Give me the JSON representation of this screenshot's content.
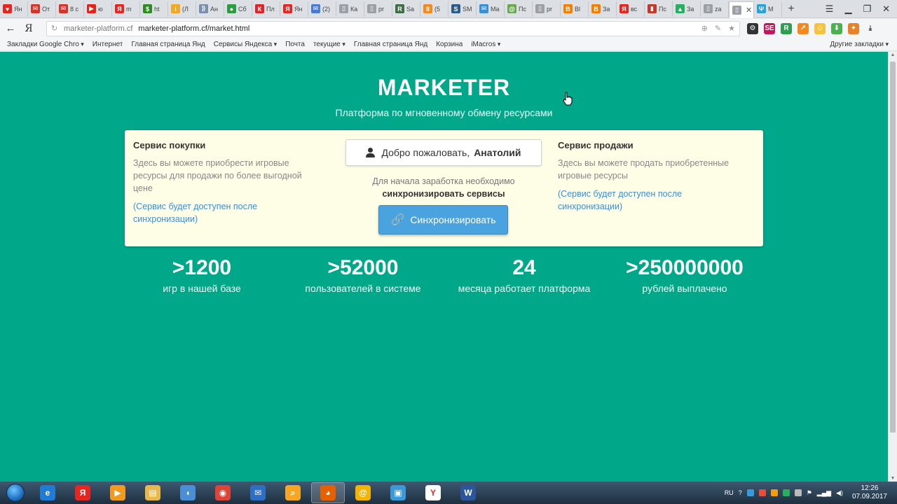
{
  "browser": {
    "tabs": [
      {
        "label": "Ян",
        "fav_color": "#e52620",
        "fav_glyph": "♥"
      },
      {
        "label": "От",
        "fav_color": "#d0362b",
        "fav_glyph": "✉"
      },
      {
        "label": "8 с",
        "fav_color": "#d0362b",
        "fav_glyph": "✉"
      },
      {
        "label": "ю",
        "fav_color": "#e62117",
        "fav_glyph": "▶"
      },
      {
        "label": "m",
        "fav_color": "#e52620",
        "fav_glyph": "Я"
      },
      {
        "label": "ht",
        "fav_color": "#2e8b22",
        "fav_glyph": "$"
      },
      {
        "label": "(Л",
        "fav_color": "#f5a623",
        "fav_glyph": "i"
      },
      {
        "label": "Ан",
        "fav_color": "#7a8fb0",
        "fav_glyph": "⟫"
      },
      {
        "label": "Сб",
        "fav_color": "#2b9c3f",
        "fav_glyph": "●"
      },
      {
        "label": "Пл",
        "fav_color": "#d9262c",
        "fav_glyph": "К"
      },
      {
        "label": "Ян",
        "fav_color": "#e52620",
        "fav_glyph": "Я"
      },
      {
        "label": "(2)",
        "fav_color": "#4a7bd0",
        "fav_glyph": "✉"
      },
      {
        "label": "Ка",
        "fav_color": "#9aa0a6",
        "fav_glyph": "▯"
      },
      {
        "label": "pr",
        "fav_color": "#9aa0a6",
        "fav_glyph": "▯"
      },
      {
        "label": "Sa",
        "fav_color": "#3c6e47",
        "fav_glyph": "R"
      },
      {
        "label": "(5",
        "fav_color": "#f28a1f",
        "fav_glyph": "8"
      },
      {
        "label": "SM",
        "fav_color": "#2a5c8a",
        "fav_glyph": "S"
      },
      {
        "label": "Ma",
        "fav_color": "#3b8fd6",
        "fav_glyph": "✉"
      },
      {
        "label": "Пс",
        "fav_color": "#6aa84f",
        "fav_glyph": "@"
      },
      {
        "label": "pr",
        "fav_color": "#9aa0a6",
        "fav_glyph": "▯"
      },
      {
        "label": "Bl",
        "fav_color": "#f57d00",
        "fav_glyph": "B"
      },
      {
        "label": "За",
        "fav_color": "#f57d00",
        "fav_glyph": "B"
      },
      {
        "label": "вс",
        "fav_color": "#e52620",
        "fav_glyph": "Я"
      },
      {
        "label": "Пс",
        "fav_color": "#c0392b",
        "fav_glyph": "▮"
      },
      {
        "label": "За",
        "fav_color": "#27ae60",
        "fav_glyph": "▲"
      },
      {
        "label": "za",
        "fav_color": "#9aa0a6",
        "fav_glyph": "▯"
      },
      {
        "label": "",
        "fav_color": "#9aa0a6",
        "fav_glyph": "▯",
        "active": true
      },
      {
        "label": "M",
        "fav_color": "#2aa1d8",
        "fav_glyph": "Ψ"
      }
    ],
    "new_tab": "+",
    "address": {
      "host": "marketer-platform.cf",
      "path": "marketer-platform.cf/market.html"
    },
    "bookmarks": [
      {
        "label": "Закладки Google Chro",
        "dropdown": true
      },
      {
        "label": "Интернет",
        "dropdown": false
      },
      {
        "label": "Главная страница Янд",
        "dropdown": false
      },
      {
        "label": "Сервисы Яндекса",
        "dropdown": true
      },
      {
        "label": "Почта",
        "dropdown": false
      },
      {
        "label": "текущие",
        "dropdown": true
      },
      {
        "label": "Главная страница Янд",
        "dropdown": false
      },
      {
        "label": "Корзина",
        "dropdown": false
      },
      {
        "label": "iMacros",
        "dropdown": true
      }
    ],
    "other_bookmarks": "Другие закладки"
  },
  "page": {
    "title": "MARKETER",
    "subtitle": "Платформа по мгновенному обмену ресурсами",
    "buy": {
      "title": "Сервис покупки",
      "text": "Здесь вы можете приобрести игровые ресурсы для продажи по более выгодной цене",
      "note": "(Сервис будет доступен после синхронизации)"
    },
    "welcome": {
      "greeting": "Добро пожаловать,",
      "name": "Анатолий"
    },
    "sync": {
      "note_line1": "Для начала заработка необходимо",
      "note_line2": "синхронизировать сервисы",
      "button": "Синхронизировать"
    },
    "sell": {
      "title": "Сервис продажи",
      "text": "Здесь вы можете продать приобретенные игровые ресурсы",
      "note": "(Сервис будет доступен после синхронизации)"
    },
    "stats": [
      {
        "value": ">1200",
        "label": "игр в нашей базе"
      },
      {
        "value": ">52000",
        "label": "пользователей в системе"
      },
      {
        "value": "24",
        "label": "месяца работает платформа"
      },
      {
        "value": ">250000000",
        "label": "рублей выплачено"
      }
    ]
  },
  "taskbar": {
    "apps": [
      {
        "name": "ie",
        "color": "#1f7bd3",
        "glyph": "e"
      },
      {
        "name": "yandex",
        "color": "#e52620",
        "glyph": "Я"
      },
      {
        "name": "media",
        "color": "#f29a1f",
        "glyph": "▶"
      },
      {
        "name": "explorer",
        "color": "#e8b84a",
        "glyph": "▤"
      },
      {
        "name": "audio",
        "color": "#4a8fd6",
        "glyph": "◖"
      },
      {
        "name": "chrome",
        "color": "#db4437",
        "glyph": "◉"
      },
      {
        "name": "thunderbird",
        "color": "#2d6fc4",
        "glyph": "✉"
      },
      {
        "name": "search",
        "color": "#f6a623",
        "glyph": "⌕"
      },
      {
        "name": "firefox",
        "color": "#e66000",
        "glyph": "◕",
        "active": true
      },
      {
        "name": "mail",
        "color": "#f5b400",
        "glyph": "@"
      },
      {
        "name": "photos",
        "color": "#3a9ad9",
        "glyph": "▣"
      },
      {
        "name": "yandex-browser",
        "color": "#ffffff",
        "glyph": "Y"
      },
      {
        "name": "word",
        "color": "#2b579a",
        "glyph": "W"
      }
    ],
    "lang": "RU",
    "time": "12:26",
    "date": "07.09.2017"
  }
}
